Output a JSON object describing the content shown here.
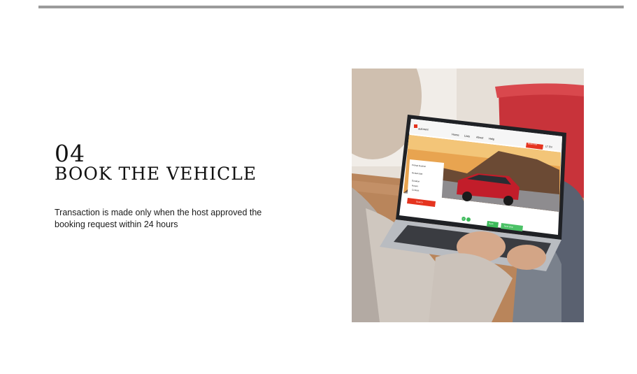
{
  "step": {
    "number": "04",
    "title": "BOOK THE VEHICLE",
    "description": "Transaction is made only when the host approved the booking request within 24 hours"
  },
  "laptop_screen": {
    "brand": "autorent",
    "nav": [
      "Home",
      "Lists",
      "About",
      "Help"
    ],
    "header_button": "Book now",
    "lang": "LT  EN",
    "form_fields": [
      "Pickup location",
      "Rental start",
      "Duration",
      "Return",
      "Contact"
    ],
    "form_button": "Search",
    "pager": "1  2",
    "bottom_buttons": [
      "Back",
      "Next step"
    ]
  },
  "colors": {
    "accent_red": "#e5341f",
    "accent_green": "#3cba5a",
    "rule_gray": "#9b9b9b"
  },
  "icons": {
    "brand_logo": "brand-logo-icon"
  }
}
